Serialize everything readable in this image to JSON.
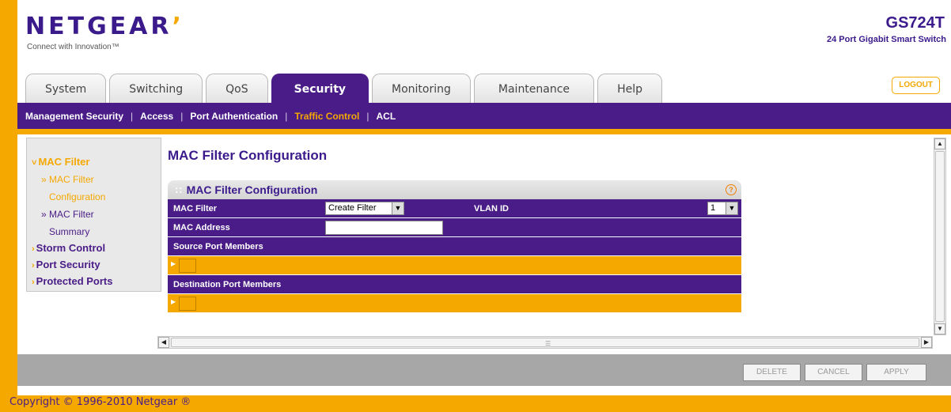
{
  "header": {
    "logo": "NETGEAR",
    "logo_mark": "’",
    "tagline": "Connect with Innovation™",
    "model": "GS724T",
    "model_sub": "24 Port Gigabit Smart Switch",
    "logout": "LOGOUT"
  },
  "tabs": [
    "System",
    "Switching",
    "QoS",
    "Security",
    "Monitoring",
    "Maintenance",
    "Help"
  ],
  "subnav": {
    "items": [
      "Management Security",
      "Access",
      "Port Authentication",
      "Traffic Control",
      "ACL"
    ],
    "separator": "|",
    "active": "Traffic Control"
  },
  "leftmenu": {
    "mac_filter": "MAC Filter",
    "mac_filter_configuration_1": "» MAC Filter",
    "mac_filter_configuration_2": "Configuration",
    "mac_filter_summary_1": "» MAC Filter",
    "mac_filter_summary_2": "Summary",
    "storm_control": "Storm Control",
    "port_security": "Port Security",
    "protected_ports": "Protected Ports"
  },
  "page": {
    "title": "MAC Filter Configuration",
    "panel_title": "MAC Filter Configuration",
    "help_icon": "?"
  },
  "form": {
    "mac_filter_label": "MAC Filter",
    "mac_filter_value": "Create Filter",
    "vlan_label": "VLAN ID",
    "vlan_value": "1",
    "mac_address_label": "MAC Address",
    "mac_address_value": "",
    "source_ports_label": "Source Port Members",
    "destination_ports_label": "Destination Port Members"
  },
  "buttons": {
    "delete": "DELETE",
    "cancel": "CANCEL",
    "apply": "APPLY"
  },
  "footer": {
    "copyright": "Copyright © 1996-2010 Netgear ®"
  },
  "colors": {
    "brand_purple": "#4a1c87",
    "brand_orange": "#f5a800"
  },
  "icons": [
    "help-icon",
    "chevron-down-icon",
    "scroll-up-icon",
    "scroll-down-icon",
    "scroll-left-icon",
    "scroll-right-icon"
  ]
}
